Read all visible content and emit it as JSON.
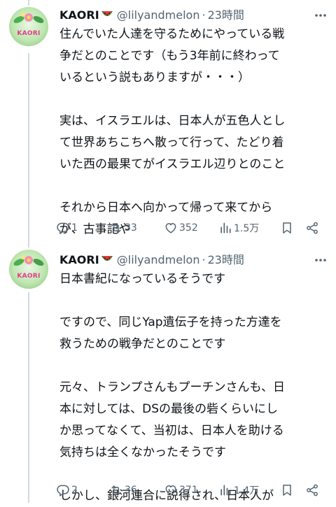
{
  "tweets": [
    {
      "display_name": "KAORI",
      "handle": "@lilyandmelon",
      "separator": "·",
      "time": "23時間",
      "avatar_text": "KAORI",
      "lines": [
        "住んでいた人達を守るためにやっている戦",
        "争だとのことです（もう3年前に終わって",
        "いるという説もありますが・・・）",
        "",
        "実は、イスラエルは、日本人が五色人とし",
        "て世界あちこちへ散って行って、たどり着",
        "いた西の最果てがイスラエル辺りとのこと",
        "",
        "それから日本へ向かって帰って来てから",
        "が、古事記や"
      ],
      "replies": "1",
      "retweets": "33",
      "likes": "352",
      "views": "1.5万"
    },
    {
      "display_name": "KAORI",
      "handle": "@lilyandmelon",
      "separator": "·",
      "time": "23時間",
      "avatar_text": "KAORI",
      "lines": [
        "日本書紀になっているそうです",
        "",
        "ですので、同じYap遺伝子を持った方達を",
        "救うための戦争だとのことです",
        "",
        "元々、トランプさんもプーチンさんも、日",
        "本に対しては、DSの最後の砦くらいにし",
        "か思ってなくて、当初は、日本人を助ける",
        "気持ちは全くなかったそうです",
        "",
        "しかし、銀河連合に説得され、日本人が"
      ],
      "replies": "2",
      "retweets": "36",
      "likes": "371",
      "views": "1.4万"
    }
  ],
  "colors": {
    "text": "#0f1419",
    "secondary": "#536471",
    "thread": "#cfd9de",
    "brand_pink": "#e23c8a"
  },
  "icons": [
    "reply-icon",
    "retweet-icon",
    "like-icon",
    "views-icon",
    "bookmark-icon",
    "share-icon",
    "more-icon",
    "watermelon-emoji"
  ]
}
